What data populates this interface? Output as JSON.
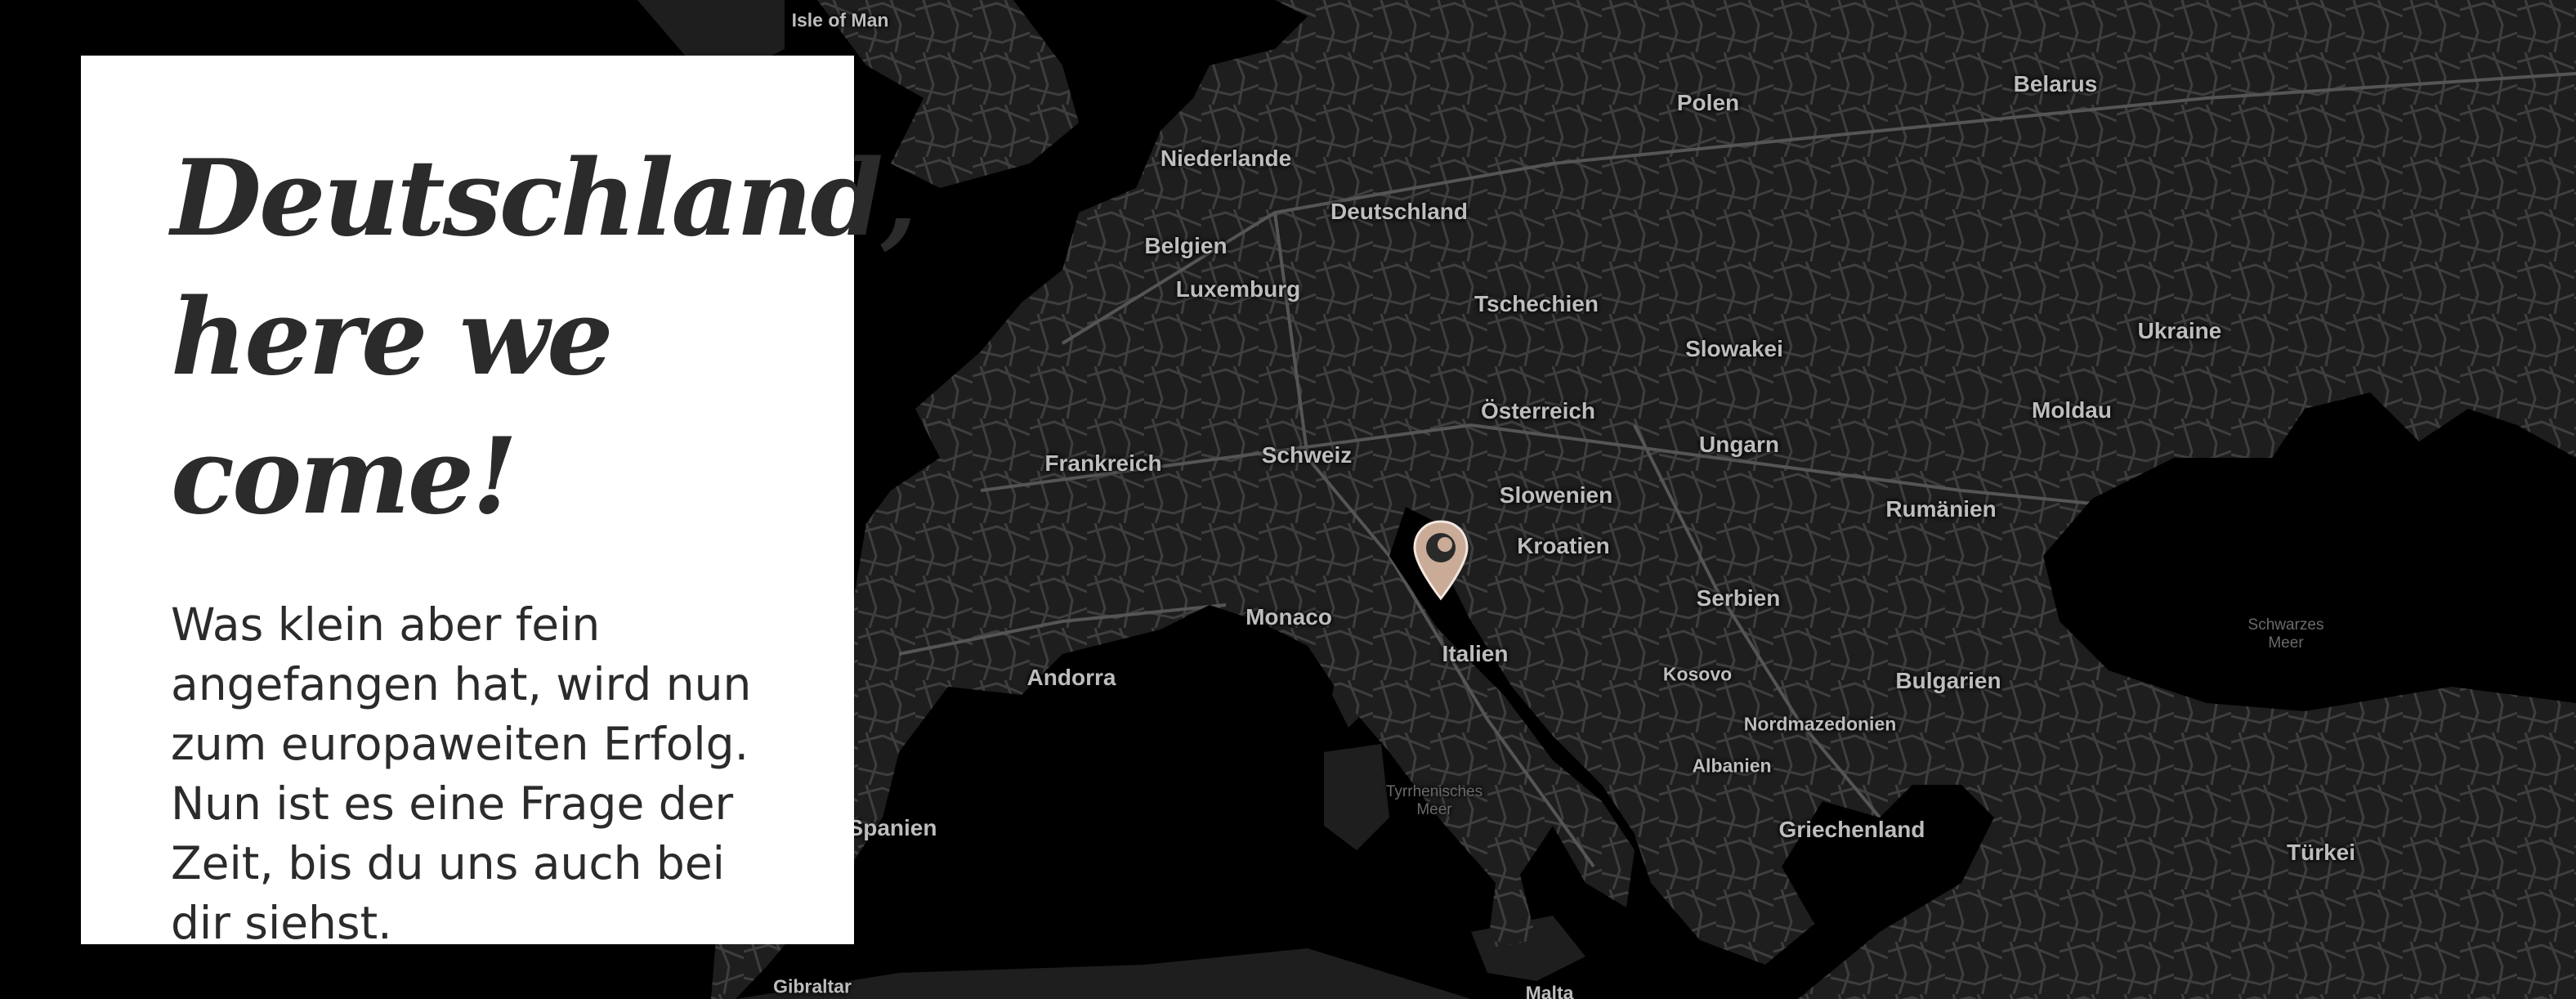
{
  "card": {
    "headline_line1": "Deutschland,",
    "headline_line2": "here we come!",
    "body": "Was klein aber fein angefangen hat, wird nun zum europaweiten Erfolg. Nun ist es eine Frage der Zeit, bis du uns auch bei dir siehst."
  },
  "map": {
    "countries": {
      "isle_of_man": "Isle of Man",
      "niederlande": "Niederlande",
      "deutschland": "Deutschland",
      "belgien": "Belgien",
      "luxemburg": "Luxemburg",
      "polen": "Polen",
      "belarus": "Belarus",
      "tschechien": "Tschechien",
      "slowakei": "Slowakei",
      "ukraine": "Ukraine",
      "oesterreich": "Österreich",
      "moldau": "Moldau",
      "frankreich": "Frankreich",
      "schweiz": "Schweiz",
      "ungarn": "Ungarn",
      "slowenien": "Slowenien",
      "rumaenien": "Rumänien",
      "kroatien": "Kroatien",
      "monaco": "Monaco",
      "serbien": "Serbien",
      "italien": "Italien",
      "andorra": "Andorra",
      "kosovo": "Kosovo",
      "bulgarien": "Bulgarien",
      "nordmazedonien": "Nordmazedonien",
      "albanien": "Albanien",
      "spanien": "Spanien",
      "griechenland": "Griechenland",
      "tuerkei": "Türkei",
      "gibraltar": "Gibraltar",
      "malta": "Malta"
    },
    "seas": {
      "schwarzes_meer": "Schwarzes\nMeer",
      "tyrrhenisches_meer": "Tyrrhenisches\nMeer"
    },
    "colors": {
      "water": "#000000",
      "land": "#1e1e1e",
      "roads": "#4a4a4a",
      "label": "#bdbdbd",
      "marker": "#c9ab98"
    },
    "marker_icon": "map-pin-icon"
  }
}
